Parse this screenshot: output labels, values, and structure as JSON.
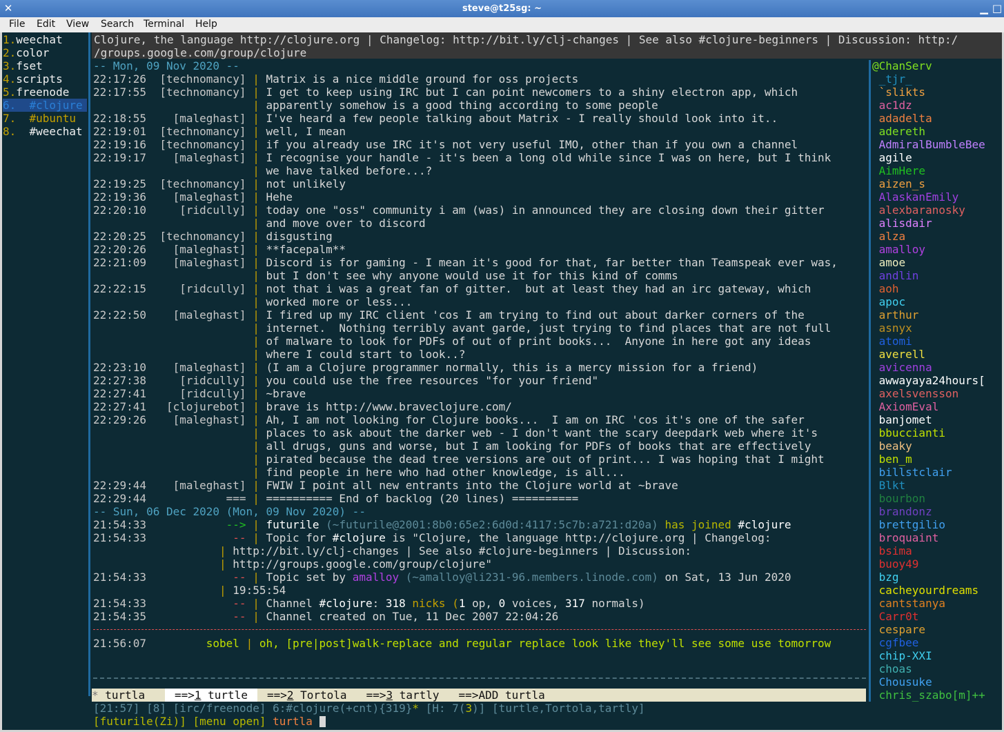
{
  "window": {
    "title": "steve@t25sg: ~"
  },
  "menu": [
    "File",
    "Edit",
    "View",
    "Search",
    "Terminal",
    "Help"
  ],
  "buffers": [
    {
      "num": "1.",
      "name": "weechat",
      "color": "#f0f0f0",
      "active": false
    },
    {
      "num": "2.",
      "name": "color",
      "color": "#f0f0f0",
      "active": false
    },
    {
      "num": "3.",
      "name": "fset",
      "color": "#f0f0f0",
      "active": false
    },
    {
      "num": "4.",
      "name": "scripts",
      "color": "#f0f0f0",
      "active": false
    },
    {
      "num": "5.",
      "name": "freenode",
      "color": "#f0f0f0",
      "active": false
    },
    {
      "num": "6.",
      "name": "  #clojure",
      "color": "#2a7fd6",
      "active": true
    },
    {
      "num": "7.",
      "name": "  #ubuntu",
      "color": "#c4a000",
      "active": false
    },
    {
      "num": "8.",
      "name": "  #weechat",
      "color": "#f0f0f0",
      "active": false
    }
  ],
  "topic": {
    "line1": "Clojure, the language http://clojure.org | Changelog: http://bit.ly/clj-changes | See also #clojure-beginners | Discussion: http:/",
    "line2": "/groups.google.com/group/clojure"
  },
  "chat": [
    {
      "kind": "date",
      "text": "-- Mon, 09 Nov 2020 --"
    },
    {
      "kind": "msg",
      "time": "22:17:26",
      "nick": "[technomancy]",
      "text": "Matrix is a nice middle ground for oss projects"
    },
    {
      "kind": "msg",
      "time": "22:17:55",
      "nick": "[technomancy]",
      "text": "I get to keep using IRC but I can point newcomers to a shiny electron app, which"
    },
    {
      "kind": "cont",
      "text": "apparently somehow is a good thing according to some people"
    },
    {
      "kind": "msg",
      "time": "22:18:55",
      "nick": "[maleghast]",
      "text": "I've heard a few people talking about Matrix - I really should look into it.."
    },
    {
      "kind": "msg",
      "time": "22:19:01",
      "nick": "[technomancy]",
      "text": "well, I mean"
    },
    {
      "kind": "msg",
      "time": "22:19:16",
      "nick": "[technomancy]",
      "text": "if you already use IRC it's not very useful IMO, other than if you own a channel"
    },
    {
      "kind": "msg",
      "time": "22:19:17",
      "nick": "[maleghast]",
      "text": "I recognise your handle - it's been a long old while since I was on here, but I think"
    },
    {
      "kind": "cont",
      "text": "we have talked before...?"
    },
    {
      "kind": "msg",
      "time": "22:19:25",
      "nick": "[technomancy]",
      "text": "not unlikely"
    },
    {
      "kind": "msg",
      "time": "22:19:36",
      "nick": "[maleghast]",
      "text": "Hehe"
    },
    {
      "kind": "msg",
      "time": "22:20:10",
      "nick": "[ridcully]",
      "text": "today one \"oss\" community i am (was) in announced they are closing down their gitter"
    },
    {
      "kind": "cont",
      "text": "and move over to discord"
    },
    {
      "kind": "msg",
      "time": "22:20:25",
      "nick": "[technomancy]",
      "text": "disgusting"
    },
    {
      "kind": "msg",
      "time": "22:20:26",
      "nick": "[maleghast]",
      "text": "**facepalm**"
    },
    {
      "kind": "msg",
      "time": "22:21:09",
      "nick": "[maleghast]",
      "text": "Discord is for gaming - I mean it's good for that, far better than Teamspeak ever was,"
    },
    {
      "kind": "cont",
      "text": "but I don't see why anyone would use it for this kind of comms"
    },
    {
      "kind": "msg",
      "time": "22:22:15",
      "nick": "[ridcully]",
      "text": "not that i was a great fan of gitter.  but at least they had an irc gateway, which"
    },
    {
      "kind": "cont",
      "text": "worked more or less..."
    },
    {
      "kind": "msg",
      "time": "22:22:50",
      "nick": "[maleghast]",
      "text": "I fired up my IRC client 'cos I am trying to find out about darker corners of the"
    },
    {
      "kind": "cont",
      "text": "internet.  Nothing terribly avant garde, just trying to find places that are not full"
    },
    {
      "kind": "cont",
      "text": "of malware to look for PDFs of out of print books...  Anyone in here got any ideas"
    },
    {
      "kind": "cont",
      "text": "where I could start to look..?"
    },
    {
      "kind": "msg",
      "time": "22:23:10",
      "nick": "[maleghast]",
      "text": "(I am a Clojure programmer normally, this is a mercy mission for a friend)"
    },
    {
      "kind": "msg",
      "time": "22:27:38",
      "nick": "[ridcully]",
      "text": "you could use the free resources \"for your friend\""
    },
    {
      "kind": "msg",
      "time": "22:27:41",
      "nick": "[ridcully]",
      "text": "~brave"
    },
    {
      "kind": "msg",
      "time": "22:27:41",
      "nick": "[clojurebot]",
      "text": "brave is http://www.braveclojure.com/"
    },
    {
      "kind": "msg",
      "time": "22:29:26",
      "nick": "[maleghast]",
      "text": "Ah, I am not looking for Clojure books...  I am on IRC 'cos it's one of the safer"
    },
    {
      "kind": "cont",
      "text": "places to ask about the darker web - I don't want the scary deepdark web where it's"
    },
    {
      "kind": "cont",
      "text": "all drugs, guns and worse, but I am looking for PDFs of books that are effectively"
    },
    {
      "kind": "cont",
      "text": "pirated because the dead tree versions are out of print... I was hoping that I might"
    },
    {
      "kind": "cont",
      "text": "find people in here who had other knowledge, is all..."
    },
    {
      "kind": "msg",
      "time": "22:29:44",
      "nick": "[maleghast]",
      "text": "FWIW I point all new entrants into the Clojure world at ~brave"
    },
    {
      "kind": "msg",
      "time": "22:29:44",
      "nick": "===",
      "text": "========== End of backlog (20 lines) =========="
    },
    {
      "kind": "date",
      "text": "-- Sun, 06 Dec 2020 (Mon, 09 Nov 2020) --"
    }
  ],
  "live": {
    "join": {
      "time": "21:54:33",
      "prefix": "-->",
      "nick": "futurile",
      "host": "(~futurile@2001:8b0:65e2:6d0d:4117:5c7b:a721:d20a)",
      "verb": "has joined",
      "chan": "#clojure"
    },
    "topic1": {
      "time": "21:54:33",
      "prefix": "--",
      "a": "Topic for ",
      "chan": "#clojure",
      "b": " is \"Clojure, the language http://clojure.org | Changelog:"
    },
    "topic2": "http://bit.ly/clj-changes | See also #clojure-beginners | Discussion:",
    "topic3": "http://groups.google.com/group/clojure\"",
    "topicset": {
      "time": "21:54:33",
      "prefix": "--",
      "a": "Topic set by ",
      "nick": "amalloy",
      "host": "(~amalloy@li231-96.members.linode.com)",
      "b": " on Sat, 13 Jun 2020"
    },
    "topicset2": "19:55:54",
    "nicks": {
      "time": "21:54:33",
      "prefix": "--",
      "a": "Channel ",
      "chan": "#clojure",
      "b": ": ",
      "n": "318",
      "c": " nicks (",
      "op": "1",
      "d": " op, ",
      "v": "0",
      "e": " voices, ",
      "norm": "317",
      "f": " normals)"
    },
    "created": {
      "time": "21:54:35",
      "prefix": "--",
      "text": "Channel created on Tue, 11 Dec 2007 22:04:26"
    },
    "sobel": {
      "time": "21:56:07",
      "nick": "sobel",
      "text": "oh, [pre|post]walk-replace and regular replace look like they'll see some use tomorrow"
    }
  },
  "nicklist": [
    {
      "n": "@ChanServ",
      "c": "#80e020"
    },
    {
      "n": " _tjr_",
      "c": "#2090c0"
    },
    {
      "n": " `slikts",
      "c": "#f0a040"
    },
    {
      "n": " ac1dz",
      "c": "#e060a0"
    },
    {
      "n": " adadelta",
      "c": "#f08040"
    },
    {
      "n": " adereth",
      "c": "#80e020"
    },
    {
      "n": " AdmiralBumbleBee",
      "c": "#c080ff"
    },
    {
      "n": " agile",
      "c": "#ffffff"
    },
    {
      "n": " AimHere",
      "c": "#20c020"
    },
    {
      "n": " aizen_s",
      "c": "#f0a040"
    },
    {
      "n": " AlaskanEmily",
      "c": "#a040e0"
    },
    {
      "n": " alexbaranosky",
      "c": "#e06060"
    },
    {
      "n": " alisdair",
      "c": "#e080ff"
    },
    {
      "n": " alza",
      "c": "#f08040"
    },
    {
      "n": " amalloy",
      "c": "#b040e0"
    },
    {
      "n": " amoe",
      "c": "#f0f0c0"
    },
    {
      "n": " andlin",
      "c": "#7040e0"
    },
    {
      "n": " aoh",
      "c": "#e06030"
    },
    {
      "n": " apoc",
      "c": "#40d0f0"
    },
    {
      "n": " arthur",
      "c": "#e0a030"
    },
    {
      "n": " asnyx",
      "c": "#c09020"
    },
    {
      "n": " atomi",
      "c": "#2060e0"
    },
    {
      "n": " averell",
      "c": "#f0e040"
    },
    {
      "n": " avicenna",
      "c": "#a040e0"
    },
    {
      "n": " awwayaya24hours[",
      "c": "#ffffff"
    },
    {
      "n": " axelsvensson",
      "c": "#e06060"
    },
    {
      "n": " AxiomEval",
      "c": "#e060a0"
    },
    {
      "n": " banjomet",
      "c": "#ffffff"
    },
    {
      "n": " bbuccianti",
      "c": "#c0e000"
    },
    {
      "n": " beaky",
      "c": "#f0c080"
    },
    {
      "n": " ben_m",
      "c": "#c0e000"
    },
    {
      "n": " billstclair",
      "c": "#40a0f0"
    },
    {
      "n": " Blkt",
      "c": "#2090c0"
    },
    {
      "n": " bourbon",
      "c": "#208040"
    },
    {
      "n": " brandonz",
      "c": "#7040c0"
    },
    {
      "n": " brettgilio",
      "c": "#40a0f0"
    },
    {
      "n": " broquaint",
      "c": "#e060a0"
    },
    {
      "n": " bsima",
      "c": "#e03030"
    },
    {
      "n": " buoy49",
      "c": "#e03030"
    },
    {
      "n": " bzg",
      "c": "#40d0f0"
    },
    {
      "n": " cacheyourdreams",
      "c": "#e0e000"
    },
    {
      "n": " cantstanya",
      "c": "#e08020"
    },
    {
      "n": " Carr0t",
      "c": "#e03030"
    },
    {
      "n": " cespare",
      "c": "#e0a030"
    },
    {
      "n": " cgfbee",
      "c": "#2060e0"
    },
    {
      "n": " chip-XXI",
      "c": "#40d0f0"
    },
    {
      "n": " choas",
      "c": "#40b0b0"
    },
    {
      "n": " Chousuke",
      "c": "#40a0f0"
    },
    {
      "n": " chris_szabo[m]++",
      "c": "#40c040"
    }
  ],
  "statusbar": {
    "star": "*",
    "nick": "turtla",
    "items": [
      {
        "arrow": "==>",
        "num": "1",
        "name": " turtle",
        "active": true
      },
      {
        "arrow": "==>",
        "num": "2",
        "name": " Tortola",
        "active": false
      },
      {
        "arrow": "==>",
        "num": "3",
        "name": " tartly",
        "active": false
      },
      {
        "arrow": "==>",
        "num": "",
        "name": "ADD turtla",
        "active": false
      }
    ]
  },
  "status2": {
    "time": "21:57",
    "buf": "8",
    "server": "irc/freenode",
    "chan": "6:#clojure",
    "mode": "(+cnt)",
    "count": "{319}",
    "star": "*",
    "hot": "H: 7",
    "hotn": "3",
    "completion": "[turtle,Tortola,tartly]"
  },
  "input": {
    "nick": "futurile",
    "mode": "Zi",
    "menu": "[menu open]",
    "text": "turtla"
  }
}
